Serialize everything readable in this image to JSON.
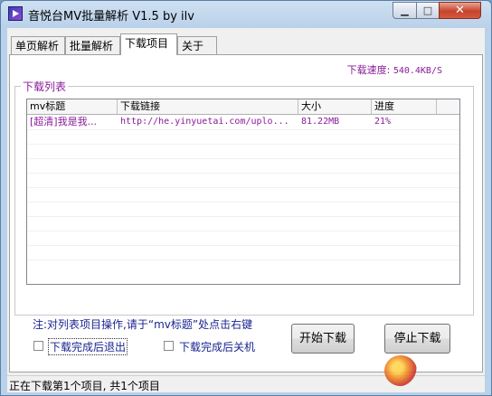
{
  "window": {
    "title": "音悦台MV批量解析 V1.5 by ilv",
    "minimize_glyph": "▁",
    "maximize_glyph": "□",
    "close_glyph": "✕"
  },
  "tabs": [
    {
      "label": "单页解析"
    },
    {
      "label": "批量解析"
    },
    {
      "label": "下载项目"
    },
    {
      "label": "关于"
    }
  ],
  "active_tab": 2,
  "speed": {
    "label": "下载速度:",
    "value": "540.4KB/S"
  },
  "download_list": {
    "group_label": "下载列表",
    "columns": [
      "mv标题",
      "下载链接",
      "大小",
      "进度"
    ],
    "rows": [
      [
        "[超清]我是我...",
        "http://he.yinyuetai.com/uplo...",
        "81.22MB",
        "21%"
      ]
    ]
  },
  "note": "注:对列表项目操作,请于“mv标题”处点击右键",
  "options": {
    "exit_after_download": {
      "label": "下载完成后退出",
      "checked": false
    },
    "shutdown_after_download": {
      "label": "下载完成后关机",
      "checked": false
    }
  },
  "buttons": {
    "start": "开始下载",
    "stop": "停止下载"
  },
  "status_bar": "正在下载第1个项目, 共1个项目",
  "colors": {
    "accent_text": "#8a1b9a",
    "note_text": "#1a2590",
    "titlebar": "#b9d1ea"
  },
  "icons": {
    "app": "app-icon"
  }
}
